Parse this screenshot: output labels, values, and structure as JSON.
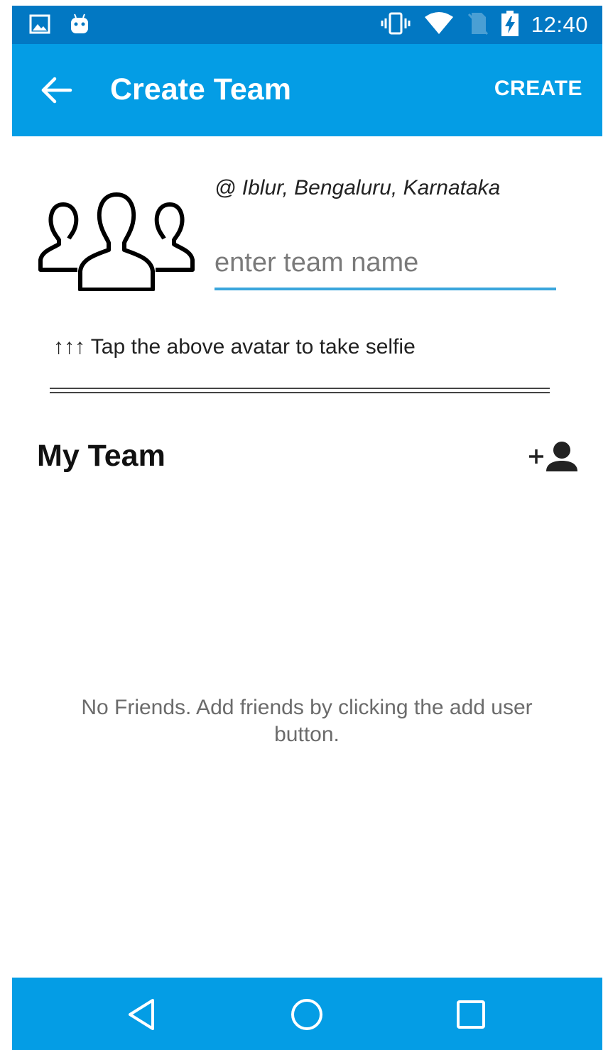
{
  "status_bar": {
    "time": "12:40",
    "icons": [
      "image-icon",
      "android-icon",
      "vibrate-icon",
      "wifi-icon",
      "no-sim-icon",
      "battery-charging-icon"
    ]
  },
  "app_bar": {
    "title": "Create Team",
    "action_label": "CREATE",
    "back_icon": "arrow-left-icon"
  },
  "form": {
    "avatar_icon": "group-icon",
    "location": "@ Iblur, Bengaluru, Karnataka",
    "team_name_placeholder": "enter team name",
    "team_name_value": "",
    "selfie_hint": "↑↑↑ Tap the above avatar to take selfie"
  },
  "team": {
    "title": "My Team",
    "add_icon": "add-user-icon",
    "empty_message": "No Friends. Add friends by clicking the add user button."
  },
  "nav_bar": {
    "icons": [
      "back-triangle-icon",
      "home-circle-icon",
      "recents-square-icon"
    ]
  },
  "colors": {
    "status_bar": "#0278c3",
    "app_bar": "#049de5",
    "input_underline": "#3aa6dc"
  }
}
